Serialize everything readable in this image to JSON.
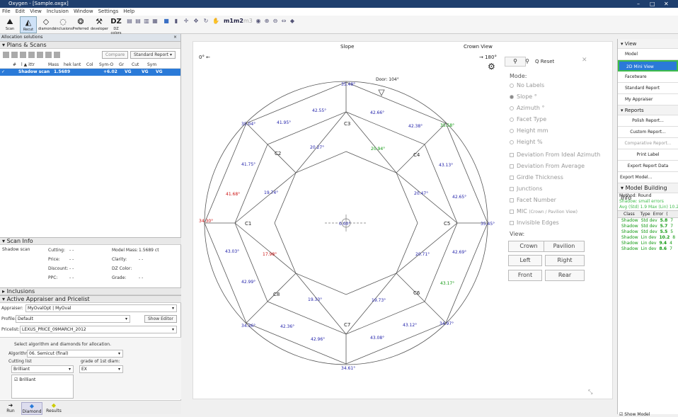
{
  "app": {
    "title": "Oxygen - [Sample.oxgx]"
  },
  "menu": [
    "File",
    "Edit",
    "View",
    "Inclusion",
    "Window",
    "Settings",
    "Help"
  ],
  "toolbar": {
    "buttons": [
      {
        "label": "Scan",
        "icon": "scan-icon"
      },
      {
        "label": "Recut",
        "icon": "recut-icon"
      },
      {
        "label": "diamonds",
        "icon": "diamonds-icon"
      },
      {
        "label": "inclusions",
        "icon": "inclusions-icon"
      },
      {
        "label": "Preferred",
        "icon": "preferred-icon"
      },
      {
        "label": "developer",
        "icon": "developer-icon"
      },
      {
        "label": "DZ colors",
        "icon": "dz-icon"
      }
    ],
    "dz_text": "DZ",
    "m_labels": [
      "m1",
      "m2",
      "m3"
    ]
  },
  "left": {
    "allocation_header": "Allocation solutions",
    "plans_title": "Plans & Scans",
    "compare_label": "Compare",
    "report_select": "Standard Report",
    "columns": [
      "#",
      "ⅼ ▲ ittr",
      "Mass",
      "hek lant",
      "Col",
      "Sym-O",
      "Gr",
      "Cut",
      "Sym"
    ],
    "selected_row": {
      "name": "Shadow scan",
      "mass": "1.5689",
      "symo": "+6.02",
      "gr": "VG",
      "cut": "VG",
      "sym": "VG"
    },
    "scan_info_title": "Scan Info",
    "scan_name": "Shadow scan",
    "scan_fields": [
      {
        "label": "Cutting:",
        "value": "- -"
      },
      {
        "label": "Price:",
        "value": "- -"
      },
      {
        "label": "Discount:",
        "value": "- -"
      },
      {
        "label": "PPC:",
        "value": "- -"
      }
    ],
    "scan_fields_right": [
      {
        "label": "Model Mass:",
        "value": "1.5689 ct"
      },
      {
        "label": "Clarity:",
        "value": "- -"
      },
      {
        "label": "DZ Color:",
        "value": ""
      },
      {
        "label": "Grade:",
        "value": "- -"
      }
    ],
    "inclusions_title": "Inclusions",
    "appraiser_title": "Active Appraiser and Pricelist",
    "appraiser_label": "Appraiser:",
    "appraiser_value": "MyOvalOpt | MyOval",
    "profile_label": "Profile:",
    "profile_value": "Default",
    "show_editor": "Show Editor",
    "pricelist_label": "Pricelist:",
    "pricelist_value": "LEXUS_PRICE_09MARCH_2012",
    "select_text": "Select algorithm and diamonds for allocation.",
    "algorithm_label": "Algorithm",
    "algorithm_value": "06. Semicut (final)",
    "cutting_list_label": "Cutting list",
    "grade_label": "grade of 1st diam:",
    "cutting_value": "Brilliant",
    "grade_value": "EX",
    "brilliant_check": "Brilliant",
    "bottom_tabs": [
      "Run",
      "Diamond",
      "Results"
    ]
  },
  "center": {
    "slope_title": "Slope",
    "crown_view": "Crown View",
    "left_angle": "0° ←",
    "right_angle": "→ 180°",
    "reset_label": "Q Reset",
    "door_label": "Door: 104°",
    "mode_title": "Mode:",
    "modes": [
      {
        "label": "No Labels",
        "type": "radio"
      },
      {
        "label": "Slope °",
        "type": "radio",
        "checked": true
      },
      {
        "label": "Azimuth °",
        "type": "radio"
      },
      {
        "label": "Facet Type",
        "type": "radio"
      },
      {
        "label": "Height mm",
        "type": "radio"
      },
      {
        "label": "Height %",
        "type": "radio"
      },
      {
        "label": "Deviation From Ideal Azimuth",
        "type": "check"
      },
      {
        "label": "Deviation From Average",
        "type": "check"
      },
      {
        "label": "Girdle Thickness",
        "type": "check"
      },
      {
        "label": "Junctions",
        "type": "check"
      },
      {
        "label": "Facet Number",
        "type": "check"
      },
      {
        "label": "MIC",
        "type": "check",
        "suffix": "(Crown / Pavilion View)"
      },
      {
        "label": "Invisible Edges",
        "type": "check"
      }
    ],
    "view_title": "View:",
    "view_buttons": [
      "Crown",
      "Pavilion",
      "Left",
      "Right",
      "Front",
      "Rear"
    ],
    "facet_labels": [
      "C1",
      "C2",
      "C3",
      "C4",
      "C5",
      "C6",
      "C7",
      "C8"
    ],
    "center_value": "0.00°",
    "angles": {
      "a1": "35.48°",
      "a2": "42.55°",
      "a3": "42.66°",
      "a4": "35.04°",
      "a5": "41.95°",
      "a6": "42.38°",
      "a7": "35.58°",
      "a8": "20.27°",
      "a9": "20.94°",
      "a10": "41.75°",
      "a11": "43.13°",
      "a12": "19.74°",
      "a13": "20.47°",
      "a14": "41.68°",
      "a15": "42.65°",
      "a16": "34.30°",
      "a17": "35.45°",
      "a18": "43.03°",
      "a19": "17.98°",
      "a20": "20.71°",
      "a21": "42.69°",
      "a22": "42.99°",
      "a23": "43.17°",
      "a24": "19.33°",
      "a25": "19.73°",
      "a26": "34.36°",
      "a27": "42.36°",
      "a28": "43.12°",
      "a29": "34.97°",
      "a30": "42.96°",
      "a31": "43.08°",
      "a32": "34.61°"
    }
  },
  "right": {
    "view_title": "View",
    "items": [
      "Model",
      "2D Mini View",
      "Facetware",
      "Standard Report",
      "My Appraiser"
    ],
    "reports_title": "Reports",
    "reports": [
      "Polish Report...",
      "Custom Report...",
      "Comparative Report...",
      "Print Label",
      "Export Report Data"
    ],
    "export_model": "Export Model...",
    "mbi_title": "Model Building Info",
    "method": "Method: Round",
    "shadow_errors": "Shadow: small errors",
    "avg": "Avg (Std) 1.9 Max (Lin) 10.2",
    "table_headers": [
      "Class",
      "Type",
      "Error",
      "("
    ],
    "table_rows": [
      [
        "Shadow",
        "Std dev",
        "5.8",
        "7"
      ],
      [
        "Shadow",
        "Std dev",
        "5.7",
        "7"
      ],
      [
        "Shadow",
        "Std dev",
        "5.5",
        "5"
      ],
      [
        "Shadow",
        "Lin dev",
        "10.2",
        "8"
      ],
      [
        "Shadow",
        "Lin dev",
        "9.4",
        "4"
      ],
      [
        "Shadow",
        "Lin dev",
        "8.6",
        "7"
      ]
    ],
    "show_model": "Show Model"
  },
  "colors": {
    "accent": "#2a7ad8",
    "green_sel": "#3dbb4a",
    "angle_blue": "#2222aa",
    "angle_red": "#cc1111",
    "angle_green": "#119911"
  }
}
